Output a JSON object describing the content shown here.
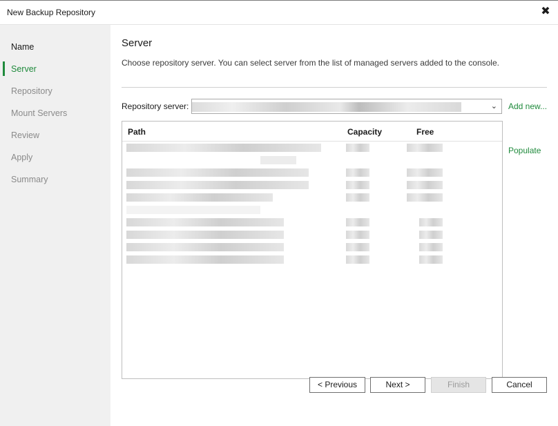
{
  "window": {
    "title": "New Backup Repository",
    "close_glyph": "✖"
  },
  "sidebar": {
    "steps": [
      {
        "label": "Name",
        "state": "done"
      },
      {
        "label": "Server",
        "state": "active"
      },
      {
        "label": "Repository",
        "state": "pending"
      },
      {
        "label": "Mount Servers",
        "state": "pending"
      },
      {
        "label": "Review",
        "state": "pending"
      },
      {
        "label": "Apply",
        "state": "pending"
      },
      {
        "label": "Summary",
        "state": "pending"
      }
    ]
  },
  "main": {
    "heading": "Server",
    "description": "Choose repository server. You can select server from the list of managed servers added to the console.",
    "server_label": "Repository server:",
    "server_value": "",
    "add_new_link": "Add new...",
    "populate_link": "Populate",
    "table": {
      "columns": [
        "Path",
        "Capacity",
        "Free"
      ]
    }
  },
  "buttons": {
    "previous": "< Previous",
    "next": "Next >",
    "finish": "Finish",
    "cancel": "Cancel"
  },
  "colors": {
    "accent": "#1f8a3c",
    "sidebar_bg": "#f0f0f0",
    "disabled_bg": "#e5e5e5"
  },
  "icons": {
    "close": "close-icon",
    "dropdown": "chevron-down-icon"
  }
}
